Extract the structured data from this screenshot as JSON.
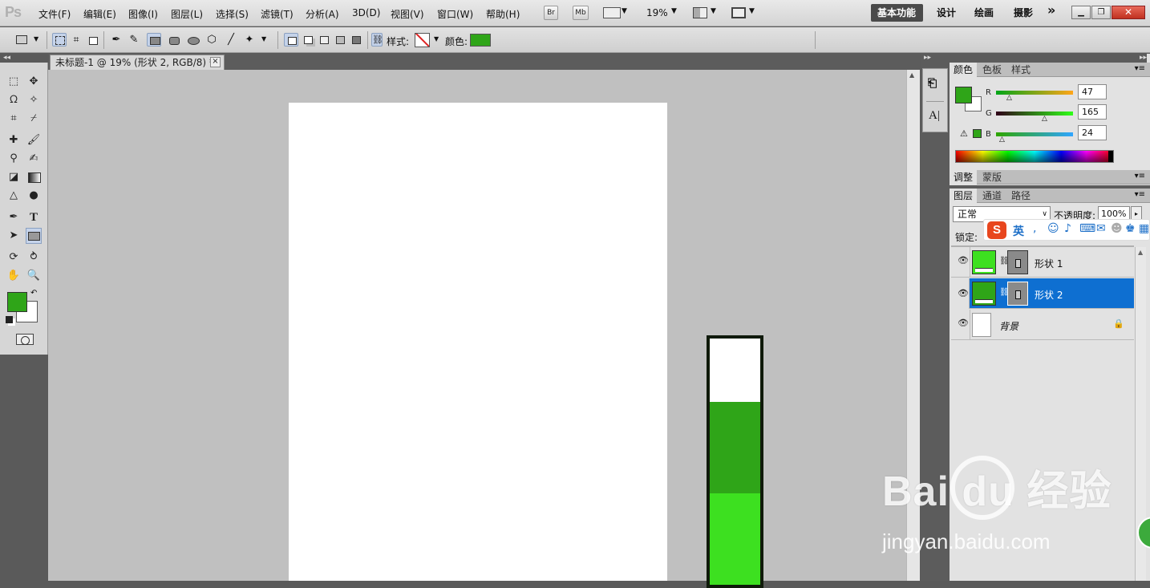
{
  "app": {
    "logo": "Ps"
  },
  "menu": [
    "文件(F)",
    "编辑(E)",
    "图像(I)",
    "图层(L)",
    "选择(S)",
    "滤镜(T)",
    "分析(A)",
    "3D(D)",
    "视图(V)",
    "窗口(W)",
    "帮助(H)"
  ],
  "appbar": {
    "br": "Br",
    "mb": "Mb",
    "zoom": "19%"
  },
  "workspaces": [
    "基本功能",
    "设计",
    "绘画",
    "摄影"
  ],
  "more_label": "»",
  "options": {
    "style_label": "样式:",
    "color_label": "颜色:",
    "color": "#2fa518"
  },
  "document": {
    "tab_title": "未标题-1 @ 19% (形状 2, RGB/8) *",
    "close": "×"
  },
  "colors": {
    "foreground": "#2fa518",
    "background": "#ffffff",
    "dark_fill": "#2fa518",
    "light_fill": "#3de020",
    "selection": "#0e6fd1"
  },
  "meter": {
    "dark_fraction": 0.37,
    "light_fraction": 0.37
  },
  "color_panel": {
    "tabs": [
      "颜色",
      "色板",
      "样式"
    ],
    "channels": [
      {
        "label": "R",
        "value": "47"
      },
      {
        "label": "G",
        "value": "165"
      },
      {
        "label": "B",
        "value": "24"
      }
    ]
  },
  "adjust_panel": {
    "tabs": [
      "调整",
      "蒙版"
    ]
  },
  "layers_panel": {
    "tabs": [
      "图层",
      "通道",
      "路径"
    ],
    "blend_mode": "正常",
    "opacity_label": "不透明度:",
    "opacity": "100%",
    "lock_label": "锁定:",
    "layers": [
      {
        "name": "形状 1",
        "selected": false
      },
      {
        "name": "形状 2",
        "selected": true
      },
      {
        "name": "背景",
        "selected": false
      }
    ]
  },
  "ime": {
    "lang": "英"
  },
  "watermark": {
    "brand": "Bai du 经验",
    "url": "jingyan.baidu.com"
  }
}
